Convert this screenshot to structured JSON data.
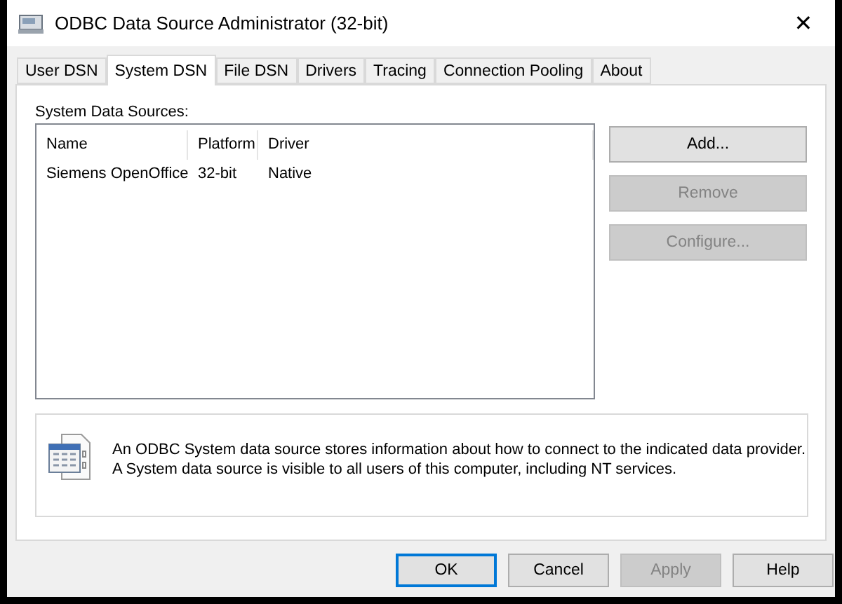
{
  "window": {
    "title": "ODBC Data Source Administrator (32-bit)",
    "close": "✕"
  },
  "tabs": [
    {
      "label": "User DSN",
      "selected": false
    },
    {
      "label": "System DSN",
      "selected": true
    },
    {
      "label": "File DSN",
      "selected": false
    },
    {
      "label": "Drivers",
      "selected": false
    },
    {
      "label": "Tracing",
      "selected": false
    },
    {
      "label": "Connection Pooling",
      "selected": false
    },
    {
      "label": "About",
      "selected": false
    }
  ],
  "list_label": "System Data Sources:",
  "table": {
    "columns": [
      "Name",
      "Platform",
      "Driver"
    ],
    "rows": [
      [
        "Siemens OpenOffice",
        "32-bit",
        "Native"
      ]
    ]
  },
  "side_buttons": [
    {
      "label": "Add...",
      "disabled": false
    },
    {
      "label": "Remove",
      "disabled": true
    },
    {
      "label": "Configure...",
      "disabled": true
    }
  ],
  "info": [
    "An ODBC System data source stores information about how to connect to the indicated data provider.",
    "A System data source is visible to all users of this computer, including NT services."
  ],
  "buttons": [
    {
      "label": "OK",
      "disabled": false,
      "default": true
    },
    {
      "label": "Cancel",
      "disabled": false,
      "default": false
    },
    {
      "label": "Apply",
      "disabled": true,
      "default": false
    },
    {
      "label": "Help",
      "disabled": false,
      "default": false
    }
  ]
}
